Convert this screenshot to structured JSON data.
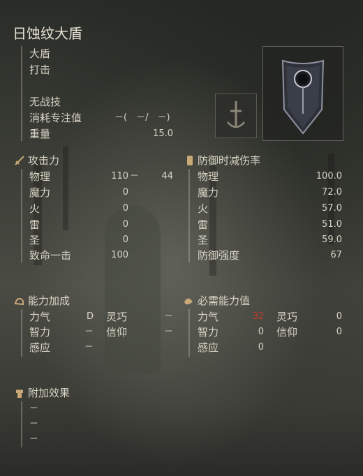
{
  "weapon": {
    "name": "日蚀纹大盾",
    "type": "大盾",
    "attack_type": "打击",
    "skill": "无战技",
    "fp_cost_label": "消耗专注值",
    "fp_cost_value": "－(　－/　－)",
    "weight_label": "重量",
    "weight_value": "15.0"
  },
  "attack": {
    "header": "攻击力",
    "rows": [
      {
        "label": "物理",
        "value": "110",
        "extra": "44",
        "sep": "－"
      },
      {
        "label": "魔力",
        "value": "0"
      },
      {
        "label": "火",
        "value": "0"
      },
      {
        "label": "雷",
        "value": "0"
      },
      {
        "label": "圣",
        "value": "0"
      },
      {
        "label": "致命一击",
        "value": "100"
      }
    ]
  },
  "defense": {
    "header": "防御时减伤率",
    "rows": [
      {
        "label": "物理",
        "value": "100.0"
      },
      {
        "label": "魔力",
        "value": "72.0"
      },
      {
        "label": "火",
        "value": "57.0"
      },
      {
        "label": "雷",
        "value": "51.0"
      },
      {
        "label": "圣",
        "value": "59.0"
      },
      {
        "label": "防御强度",
        "value": "67"
      }
    ]
  },
  "scaling": {
    "header": "能力加成",
    "str_label": "力气",
    "str_value": "D",
    "dex_label": "灵巧",
    "dex_value": "－",
    "int_label": "智力",
    "int_value": "－",
    "fai_label": "信仰",
    "fai_value": "－",
    "arc_label": "感应",
    "arc_value": "－"
  },
  "requirements": {
    "header": "必需能力值",
    "str_label": "力气",
    "str_value": "32",
    "dex_label": "灵巧",
    "dex_value": "0",
    "int_label": "智力",
    "int_value": "0",
    "fai_label": "信仰",
    "fai_value": "0",
    "arc_label": "感应",
    "arc_value": "0"
  },
  "passive": {
    "header": "附加效果",
    "items": [
      "－",
      "－",
      "－"
    ]
  },
  "colors": {
    "unmet_requirement": "#b83a2e",
    "text": "#d9d4c6"
  },
  "icons": {
    "attack": "sword-icon",
    "defense": "shield-icon",
    "scaling": "arm-icon",
    "requirements": "hand-icon",
    "passive": "armor-icon",
    "ash_of_war": "sword-slot-icon"
  }
}
